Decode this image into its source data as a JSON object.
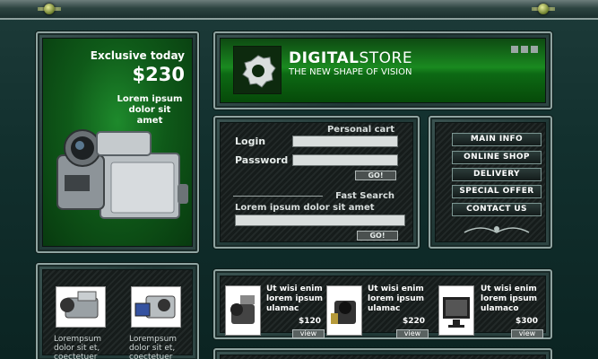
{
  "exclusive": {
    "title": "Exclusive today",
    "price": "$230",
    "desc": "Lorem ipsum dolor sit amet"
  },
  "header": {
    "brand_bold": "DIGITAL",
    "brand_rest": "STORE",
    "tagline": "THE NEW SHAPE OF  VISION"
  },
  "cart": {
    "title": "Personal cart",
    "login_label": "Login",
    "password_label": "Password",
    "go_label": "GO!",
    "search_title": "Fast Search",
    "search_text": "Lorem ipsum dolor sit amet",
    "search_go": "GO!"
  },
  "menu": {
    "items": [
      "MAIN INFO",
      "ONLINE SHOP",
      "DELIVERY",
      "SPECIAL OFFER",
      "CONTACT US"
    ]
  },
  "thumbs": {
    "items": [
      {
        "text": "Lorempsum dolor sit et, coectetuer"
      },
      {
        "text": "Lorempsum dolor sit et, coectetuer"
      }
    ]
  },
  "products": {
    "items": [
      {
        "title": "Ut wisi enim lorem ipsum ulamac",
        "price": "$120",
        "view": "view"
      },
      {
        "title": "Ut wisi enim lorem ipsum ulamac",
        "price": "$220",
        "view": "view"
      },
      {
        "title": "Ut wisi enim lorem ipsum ulamaco",
        "price": "$300",
        "view": "view"
      }
    ]
  },
  "colors": {
    "accent_green": "#1a8a20",
    "frame": "#8fa3a0",
    "background": "#0e2a28"
  }
}
